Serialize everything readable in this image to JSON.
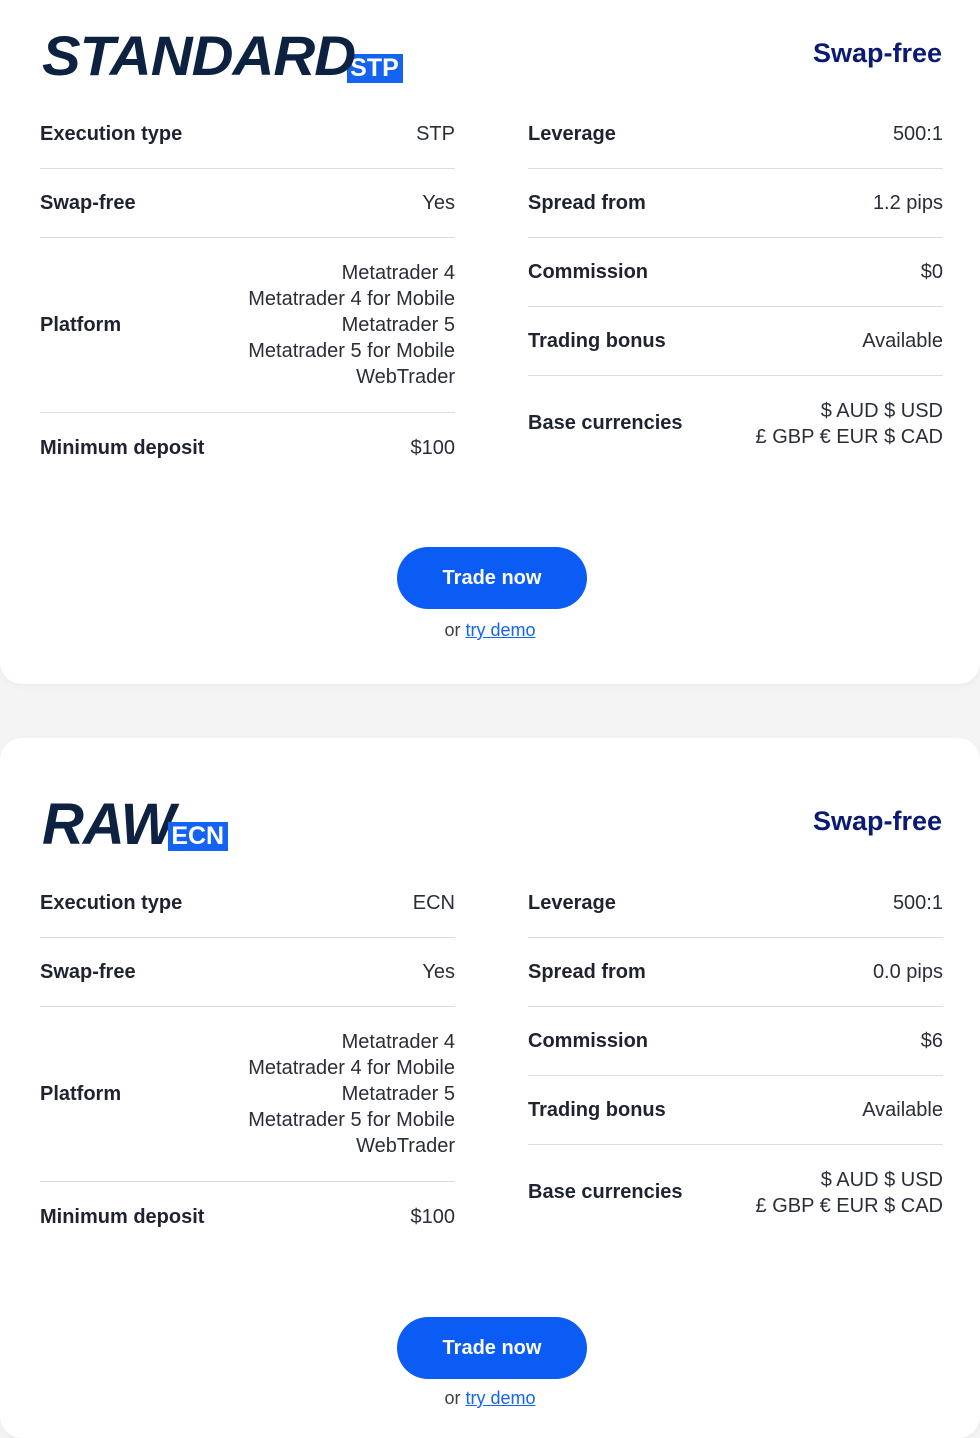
{
  "accounts": [
    {
      "logo_word": "STANDARD",
      "logo_tag": "STP",
      "swap_title": "Swap-free",
      "left": {
        "execution_label": "Execution type",
        "execution_value": "STP",
        "swap_label": "Swap-free",
        "swap_value": "Yes",
        "platform_label": "Platform",
        "platforms": [
          "Metatrader 4",
          "Metatrader 4 for Mobile",
          "Metatrader 5",
          "Metatrader 5 for Mobile",
          "WebTrader"
        ],
        "min_deposit_label": "Minimum deposit",
        "min_deposit_value": "$100"
      },
      "right": {
        "leverage_label": "Leverage",
        "leverage_value": "500:1",
        "spread_label": "Spread from",
        "spread_value": "1.2 pips",
        "commission_label": "Commission",
        "commission_value": "$0",
        "bonus_label": "Trading bonus",
        "bonus_value": "Available",
        "base_label": "Base currencies",
        "base_lines": [
          "$ AUD $ USD",
          "£ GBP € EUR $ CAD"
        ]
      },
      "trade_label": "Trade now",
      "or_text": "or",
      "demo_label": "try demo"
    },
    {
      "logo_word": "RAW",
      "logo_tag": "ECN",
      "swap_title": "Swap-free",
      "left": {
        "execution_label": "Execution type",
        "execution_value": "ECN",
        "swap_label": "Swap-free",
        "swap_value": "Yes",
        "platform_label": "Platform",
        "platforms": [
          "Metatrader 4",
          "Metatrader 4 for Mobile",
          "Metatrader 5",
          "Metatrader 5 for Mobile",
          "WebTrader"
        ],
        "min_deposit_label": "Minimum deposit",
        "min_deposit_value": "$100"
      },
      "right": {
        "leverage_label": "Leverage",
        "leverage_value": "500:1",
        "spread_label": "Spread from",
        "spread_value": "0.0 pips",
        "commission_label": "Commission",
        "commission_value": "$6",
        "bonus_label": "Trading bonus",
        "bonus_value": "Available",
        "base_label": "Base currencies",
        "base_lines": [
          "$ AUD $ USD",
          "£ GBP € EUR $ CAD"
        ]
      },
      "trade_label": "Trade now",
      "or_text": "or",
      "demo_label": "try demo"
    }
  ]
}
